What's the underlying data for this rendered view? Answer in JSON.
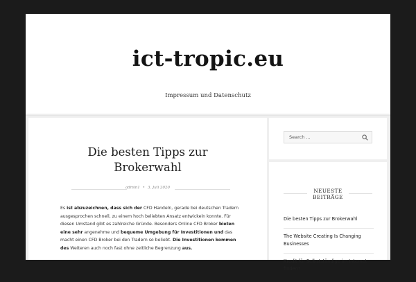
{
  "site": {
    "title": "ict-tropic.eu",
    "nav_link": "Impressum und Datenschutz"
  },
  "post": {
    "title_line1": "Die besten Tipps zur",
    "title_line2": "Brokerwahl",
    "author": "admin1",
    "meta_separator": "•",
    "date": "3. Juli 2020",
    "body": [
      {
        "text": "Es ",
        "bold": false
      },
      {
        "text": "ist abzuzeichnen, dass sich der",
        "bold": true
      },
      {
        "text": " CFD Handeln, gerade bei deutschen Tradern ausgesprochen schnell, zu einem hoch beliebten Ansatz entwickeln konnte. Für diesen Umstand gibt es zahlreiche Gründe. Besonders Online CFD Broker ",
        "bold": false
      },
      {
        "text": "bieten eine sehr",
        "bold": true
      },
      {
        "text": " angenehme und ",
        "bold": false
      },
      {
        "text": "bequeme Umgebung für Investitionen und",
        "bold": true
      },
      {
        "text": " das macht einen CFD Broker bei den Tradern so beliebt. ",
        "bold": false
      },
      {
        "text": "Die Investitionen kommen des",
        "bold": true
      },
      {
        "text": " Weiteren auch noch fast ohne zeitliche Begrenzung ",
        "bold": false
      },
      {
        "text": "aus.",
        "bold": true
      }
    ]
  },
  "sidebar": {
    "search_placeholder": "Search ...",
    "recent_title_line1": "NEUESTE",
    "recent_title_line2": "BEITRÄGE",
    "recent_posts": [
      "Die besten Tipps zur Brokerwahl",
      "The Website Creating Is Changing Businesses",
      "Kredit für Selbstständige im Internet finden?"
    ]
  },
  "colors": {
    "outer_background": "#1b1b1b",
    "content_background": "#ffffff",
    "gutter": "#efefef",
    "text": "#222222"
  },
  "icons": {
    "search": "search-icon"
  }
}
